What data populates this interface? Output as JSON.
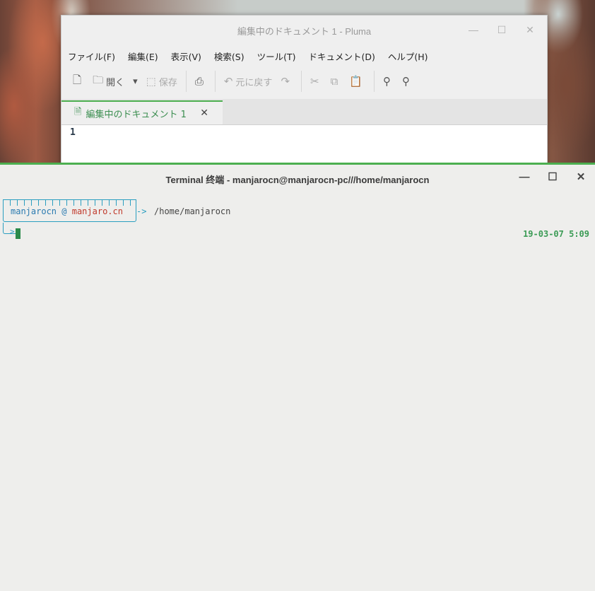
{
  "pluma": {
    "title": "編集中のドキュメント 1 - Pluma",
    "menu": [
      "ファイル(F)",
      "編集(E)",
      "表示(V)",
      "検索(S)",
      "ツール(T)",
      "ドキュメント(D)",
      "ヘルプ(H)"
    ],
    "toolbar": {
      "open_label": "開く",
      "save_label": "保存",
      "undo_label": "元に戻す"
    },
    "tab": {
      "label": "編集中のドキュメント 1"
    },
    "editor": {
      "line_number": "1"
    }
  },
  "terminal": {
    "title": "Terminal 终端 - manjarocn@manjarocn-pc///home/manjarocn",
    "user": "manjarocn",
    "at": "@",
    "host": "manjaro.cn",
    "arrow": "->",
    "path": "/home/manjarocn",
    "timestamp": "19-03-07 5:09"
  },
  "colors": {
    "accent_green": "#4caf50",
    "prompt_blue": "#2a9ec0",
    "host_red": "#c0392b"
  }
}
